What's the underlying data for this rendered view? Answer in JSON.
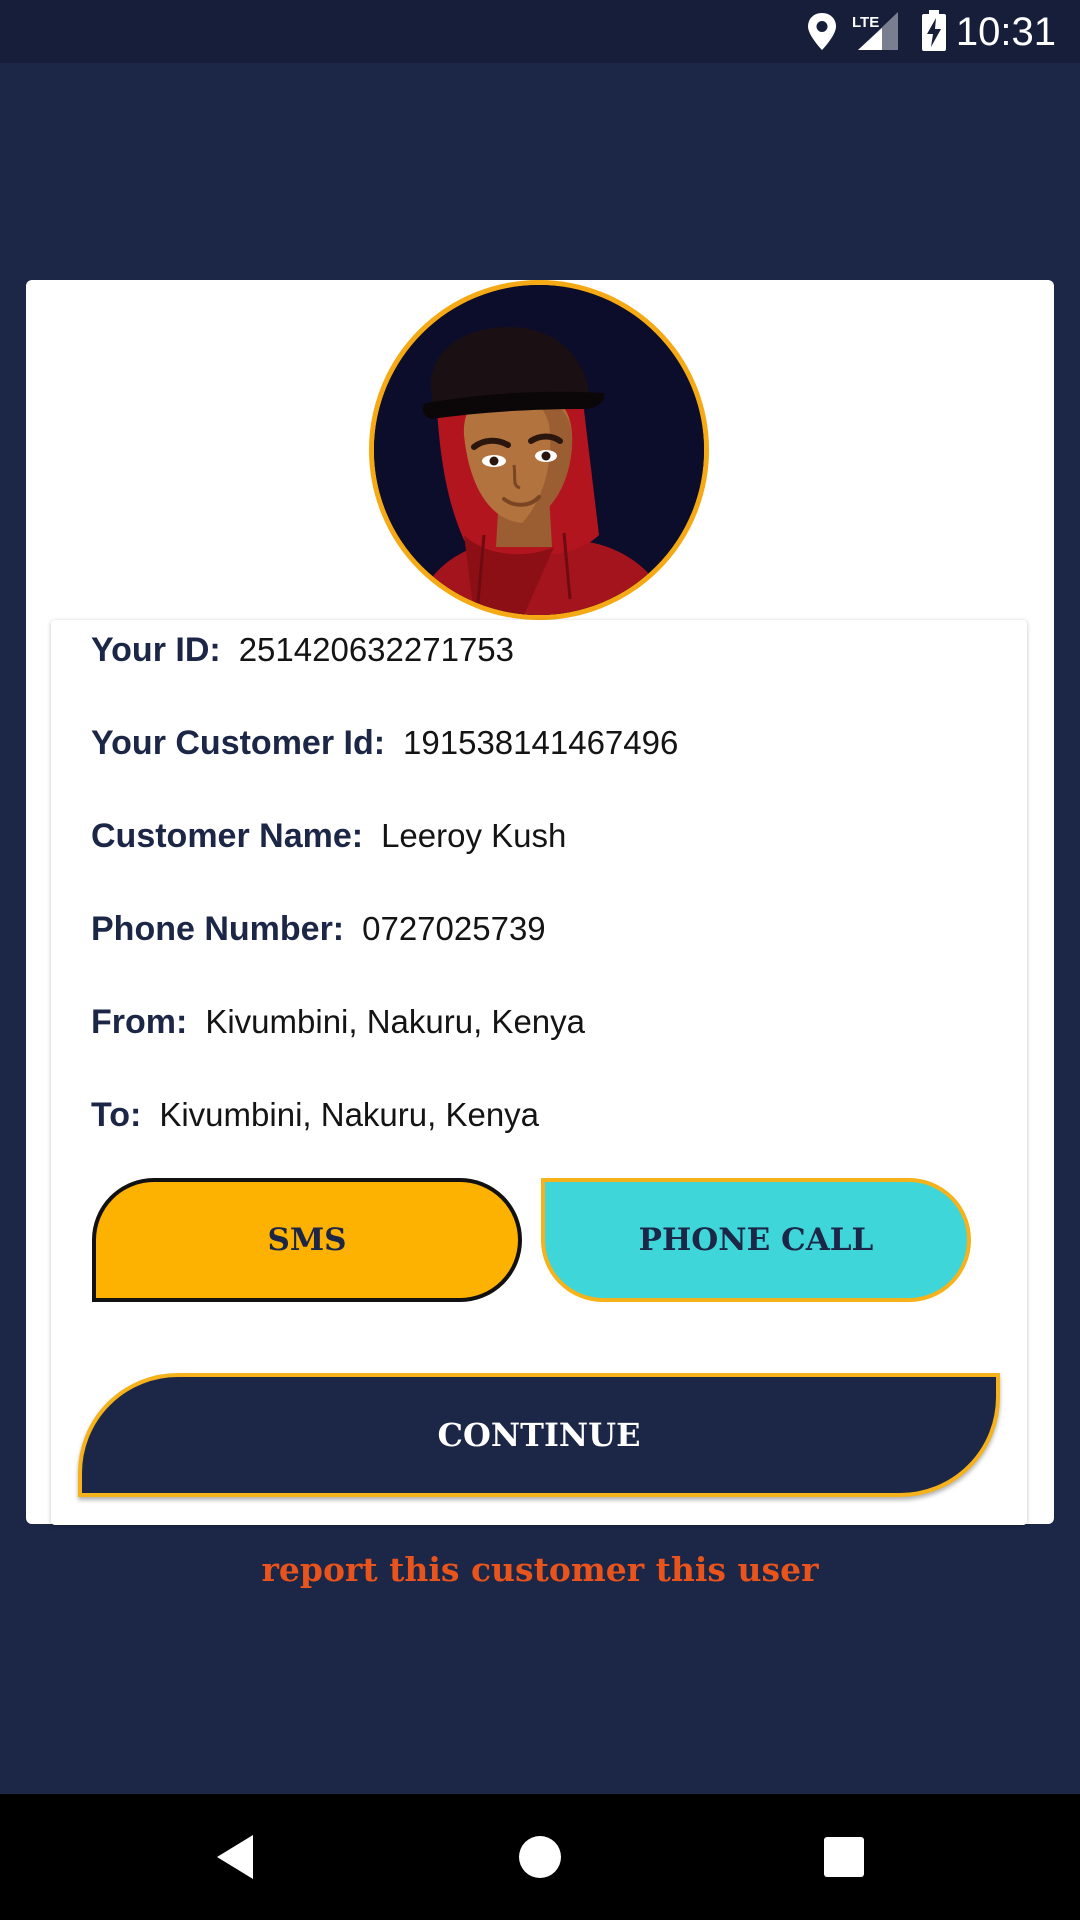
{
  "status_bar": {
    "time": "10:31",
    "icons": [
      "location-icon",
      "lte-signal-icon",
      "battery-charging-icon"
    ],
    "network_label": "LTE"
  },
  "avatar": {
    "icon": "user-avatar-illustration"
  },
  "details": {
    "your_id": {
      "label": "Your ID:",
      "value": "251420632271753"
    },
    "customer_id": {
      "label": "Your Customer Id:",
      "value": "191538141467496"
    },
    "customer_name": {
      "label": "Customer Name:",
      "value": "Leeroy Kush"
    },
    "phone_number": {
      "label": "Phone Number:",
      "value": "0727025739"
    },
    "from": {
      "label": "From:",
      "value": "Kivumbini, Nakuru, Kenya"
    },
    "to": {
      "label": "To:",
      "value": "Kivumbini, Nakuru, Kenya"
    }
  },
  "buttons": {
    "sms": "SMS",
    "phone_call": "PHONE CALL",
    "continue": "CONTINUE"
  },
  "report_link": "report this customer this user",
  "nav": {
    "icons": [
      "back-icon",
      "home-icon",
      "recents-icon"
    ]
  },
  "colors": {
    "background": "#1c2646",
    "status_bar": "#161e3a",
    "accent_yellow": "#fdb100",
    "accent_cyan": "#3fd6da",
    "report_orange": "#e8541b"
  }
}
